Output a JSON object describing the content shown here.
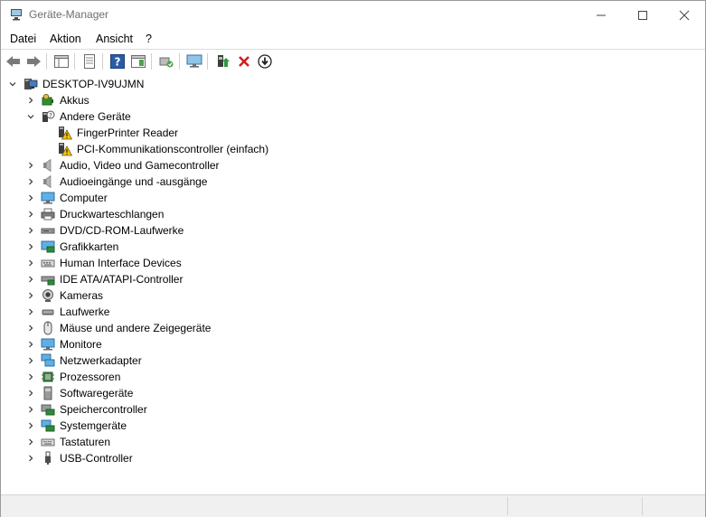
{
  "window": {
    "title": "Geräte-Manager"
  },
  "menu": [
    "Datei",
    "Aktion",
    "Ansicht",
    "?"
  ],
  "toolbar": [
    "back-icon",
    "forward-icon",
    "show-hide-console-tree-icon",
    "properties-icon",
    "help-icon",
    "action-pane-icon",
    "scan-hardware-changes-icon",
    "monitor-icon",
    "update-driver-icon",
    "uninstall-icon",
    "disable-device-icon"
  ],
  "tree": {
    "root": "DESKTOP-IV9UJMN",
    "items": [
      {
        "label": "Akkus",
        "icon": "battery-icon",
        "expanded": false
      },
      {
        "label": "Andere Geräte",
        "icon": "unknown-device-icon",
        "expanded": true,
        "children": [
          {
            "label": "FingerPrinter Reader",
            "icon": "warning-device-icon"
          },
          {
            "label": "PCI-Kommunikationscontroller (einfach)",
            "icon": "warning-device-icon"
          }
        ]
      },
      {
        "label": "Audio, Video und Gamecontroller",
        "icon": "speaker-icon",
        "expanded": false
      },
      {
        "label": "Audioeingänge und -ausgänge",
        "icon": "speaker-icon",
        "expanded": false
      },
      {
        "label": "Computer",
        "icon": "monitor-icon",
        "expanded": false
      },
      {
        "label": "Druckwarteschlangen",
        "icon": "printer-icon",
        "expanded": false
      },
      {
        "label": "DVD/CD-ROM-Laufwerke",
        "icon": "dvd-drive-icon",
        "expanded": false
      },
      {
        "label": "Grafikkarten",
        "icon": "display-adapter-icon",
        "expanded": false
      },
      {
        "label": "Human Interface Devices",
        "icon": "hid-icon",
        "expanded": false
      },
      {
        "label": "IDE ATA/ATAPI-Controller",
        "icon": "ide-controller-icon",
        "expanded": false
      },
      {
        "label": "Kameras",
        "icon": "camera-icon",
        "expanded": false
      },
      {
        "label": "Laufwerke",
        "icon": "disk-drive-icon",
        "expanded": false
      },
      {
        "label": "Mäuse und andere Zeigegeräte",
        "icon": "mouse-icon",
        "expanded": false
      },
      {
        "label": "Monitore",
        "icon": "monitor-icon",
        "expanded": false
      },
      {
        "label": "Netzwerkadapter",
        "icon": "network-adapter-icon",
        "expanded": false
      },
      {
        "label": "Prozessoren",
        "icon": "processor-icon",
        "expanded": false
      },
      {
        "label": "Softwaregeräte",
        "icon": "software-device-icon",
        "expanded": false
      },
      {
        "label": "Speichercontroller",
        "icon": "storage-controller-icon",
        "expanded": false
      },
      {
        "label": "Systemgeräte",
        "icon": "system-device-icon",
        "expanded": false
      },
      {
        "label": "Tastaturen",
        "icon": "keyboard-icon",
        "expanded": false
      },
      {
        "label": "USB-Controller",
        "icon": "usb-icon",
        "expanded": false
      }
    ]
  },
  "colors": {
    "accent": "#1a5fb4",
    "warning": "#f5c518",
    "error": "#d11f1f"
  }
}
